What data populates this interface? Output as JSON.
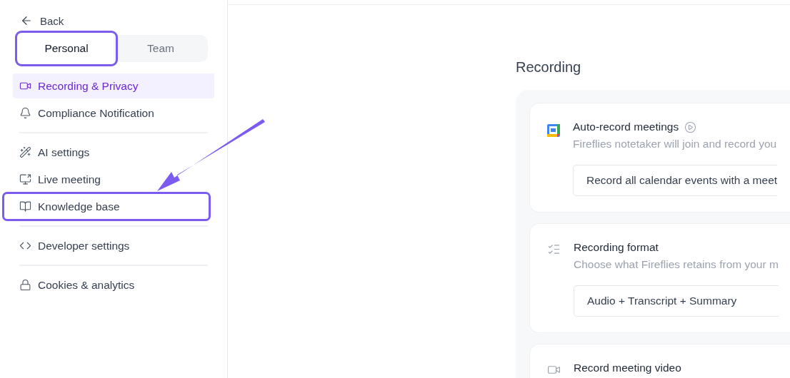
{
  "sidebar": {
    "back": {
      "label": "Back"
    },
    "tabs": [
      {
        "label": "Personal",
        "selected": true,
        "highlighted": true
      },
      {
        "label": "Team",
        "selected": false,
        "highlighted": false
      }
    ],
    "groups": [
      {
        "items": [
          {
            "label": "Recording & Privacy",
            "selected": true,
            "highlighted": false
          },
          {
            "label": "Compliance Notification",
            "selected": false,
            "highlighted": false
          }
        ]
      },
      {
        "items": [
          {
            "label": "AI settings",
            "selected": false,
            "highlighted": false
          },
          {
            "label": "Live meeting",
            "selected": false,
            "highlighted": false
          },
          {
            "label": "Knowledge base",
            "selected": false,
            "highlighted": true
          }
        ]
      },
      {
        "items": [
          {
            "label": "Developer settings",
            "selected": false,
            "highlighted": false
          }
        ]
      },
      {
        "items": [
          {
            "label": "Cookies & analytics",
            "selected": false,
            "highlighted": false
          }
        ]
      }
    ]
  },
  "annotation": {
    "kind": "arrow"
  },
  "main": {
    "title": "Recording",
    "cards": [
      {
        "title": "Auto-record meetings",
        "description": "Fireflies notetaker will join and record you",
        "value": "Record all calendar events with a meet"
      },
      {
        "title": "Recording format",
        "description": "Choose what Fireflies retains from your m",
        "value": "Audio + Transcript + Summary"
      },
      {
        "title": "Record meeting video"
      }
    ]
  }
}
